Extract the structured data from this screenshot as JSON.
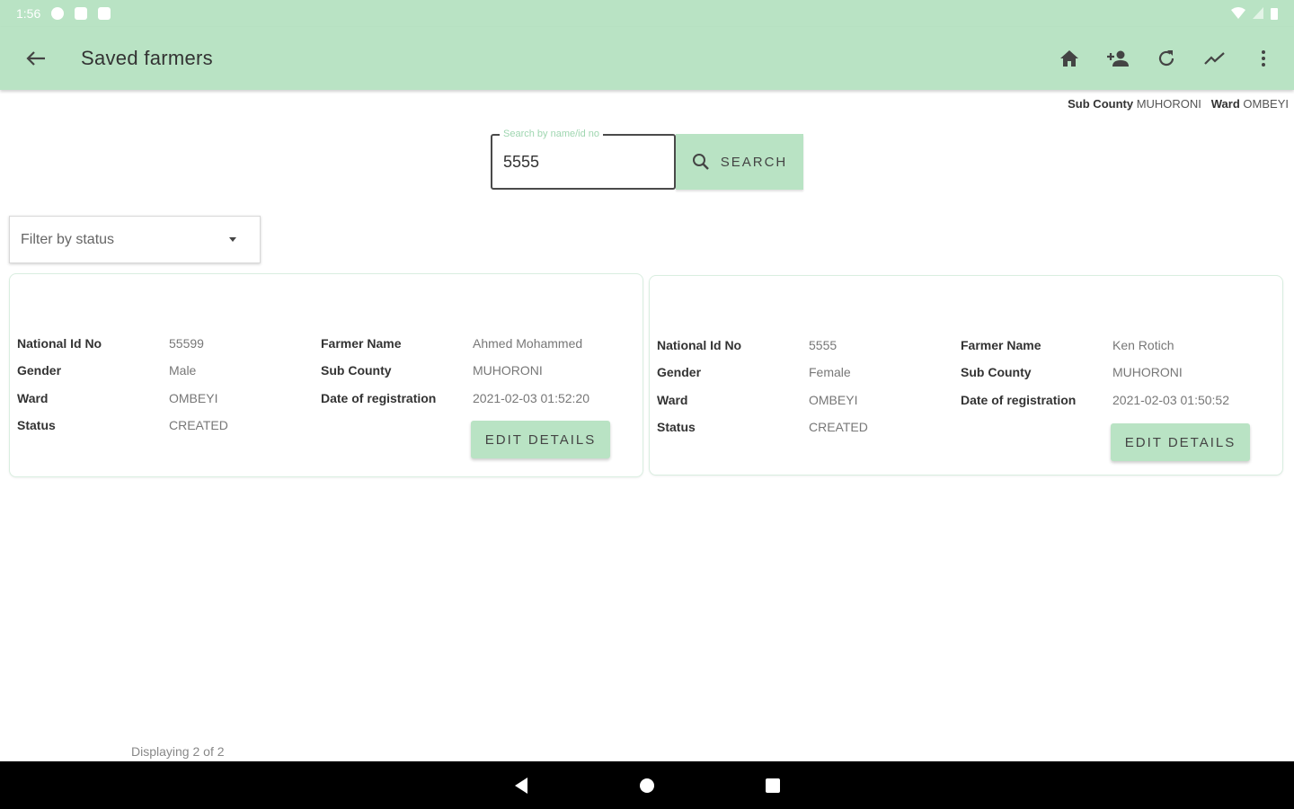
{
  "status_bar": {
    "time": "1:56"
  },
  "app_bar": {
    "title": "Saved farmers"
  },
  "location": {
    "sub_county_label": "Sub County",
    "sub_county": "MUHORONI",
    "ward_label": "Ward",
    "ward": "OMBEYI"
  },
  "search": {
    "placeholder": "Search by name/id no",
    "value": "5555",
    "button_label": "SEARCH"
  },
  "filter": {
    "placeholder": "Filter by status"
  },
  "labels": {
    "national_id": "National Id No",
    "gender": "Gender",
    "ward": "Ward",
    "status": "Status",
    "farmer_name": "Farmer Name",
    "sub_county": "Sub County",
    "date_registration": "Date of registration",
    "edit_button": "EDIT DETAILS"
  },
  "farmers": [
    {
      "national_id": "55599",
      "gender": "Male",
      "ward": "OMBEYI",
      "status": "CREATED",
      "farmer_name": "Ahmed Mohammed",
      "sub_county": "MUHORONI",
      "date_registration": "2021-02-03 01:52:20"
    },
    {
      "national_id": "5555",
      "gender": "Female",
      "ward": "OMBEYI",
      "status": "CREATED",
      "farmer_name": "Ken Rotich",
      "sub_county": "MUHORONI",
      "date_registration": "2021-02-03 01:50:52"
    }
  ],
  "footer": {
    "count_text": "Displaying 2 of 2"
  },
  "colors": {
    "accent": "#b9e3c4",
    "text": "#333333",
    "nav_bar": "#000000"
  }
}
